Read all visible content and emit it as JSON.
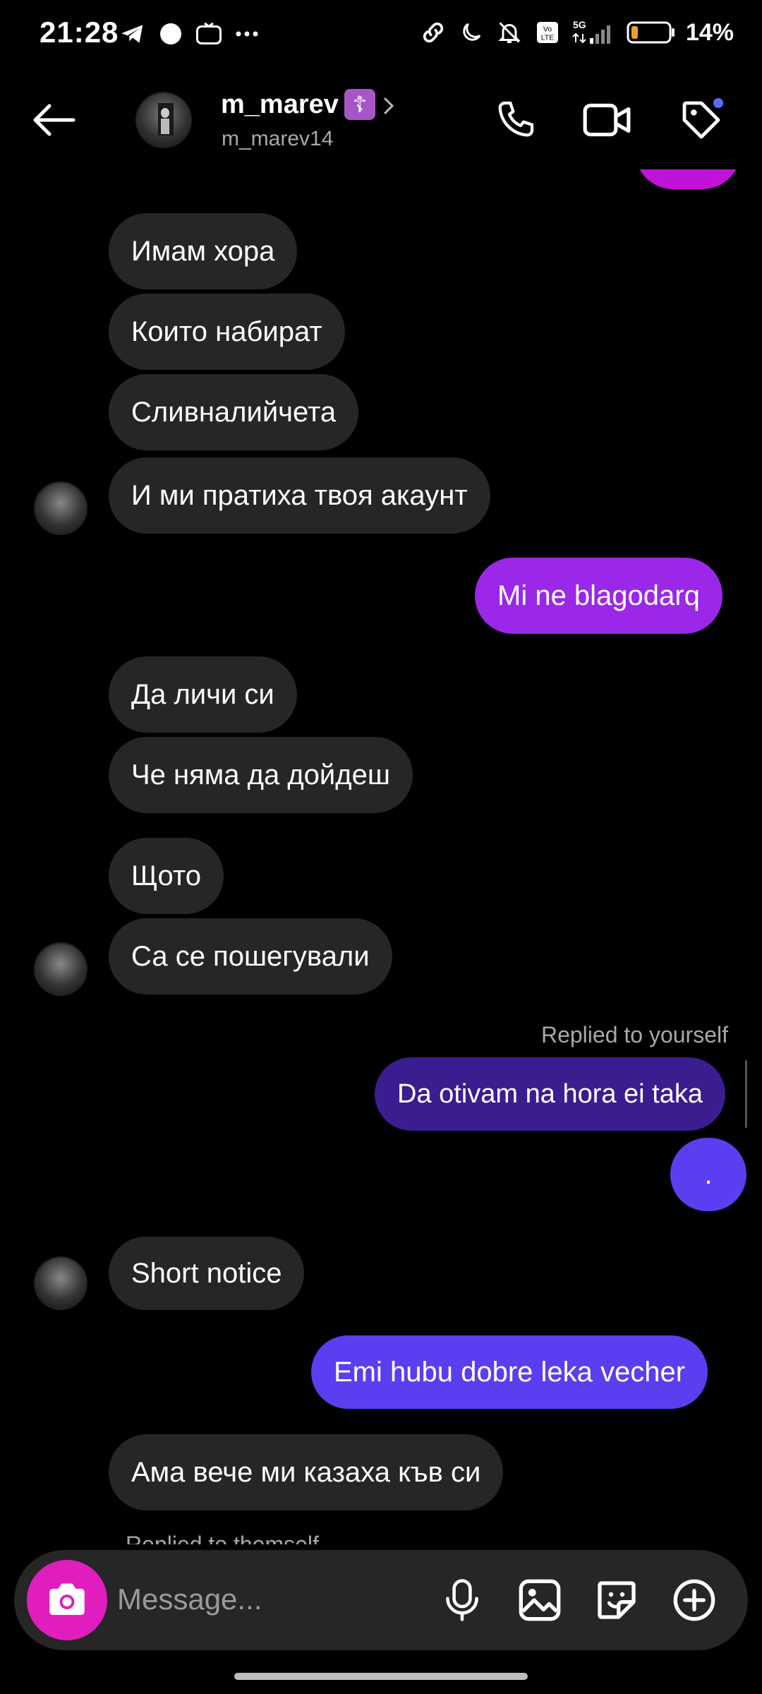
{
  "status_bar": {
    "time": "21:28",
    "battery_percent": "14%",
    "battery_level": 0.14,
    "icons_left": [
      "telegram-icon",
      "circle-icon",
      "ometv-icon",
      "more-dots-icon"
    ],
    "icons_right": [
      "link-icon",
      "moon-icon",
      "mute-bell-icon",
      "volte-icon",
      "signal-5g-icon",
      "battery-icon"
    ]
  },
  "header": {
    "name": "m_marev",
    "badge_glyph": "☦",
    "username": "m_marev14"
  },
  "messages": [
    {
      "text": "Имам хора"
    },
    {
      "text": "Които набират"
    },
    {
      "text": "Сливналийчета"
    },
    {
      "text": "И ми пратиха твоя акаунт"
    },
    {
      "text": "Mi ne blagodarq"
    },
    {
      "text": "Да личи си"
    },
    {
      "text": "Че няма да дойдеш"
    },
    {
      "text": "Щото"
    },
    {
      "text": "Са се пошегували"
    },
    {
      "text": "Replied to yourself"
    },
    {
      "text": "Da otivam na hora ei taka"
    },
    {
      "text": "."
    },
    {
      "text": "Short notice"
    },
    {
      "text": "Emi hubu dobre leka vecher"
    },
    {
      "text": "Ама вече ми казаха къв си"
    },
    {
      "text": "Replied to themself"
    }
  ],
  "composer": {
    "placeholder": "Message..."
  },
  "colors": {
    "incoming": "#262626",
    "outgoing_purple": "#9b27e8",
    "outgoing_indigo": "#3b1d8f",
    "outgoing_violet": "#5b3ef0",
    "camera_button": "#e01ebd",
    "notification_dot": "#5b6bff"
  }
}
